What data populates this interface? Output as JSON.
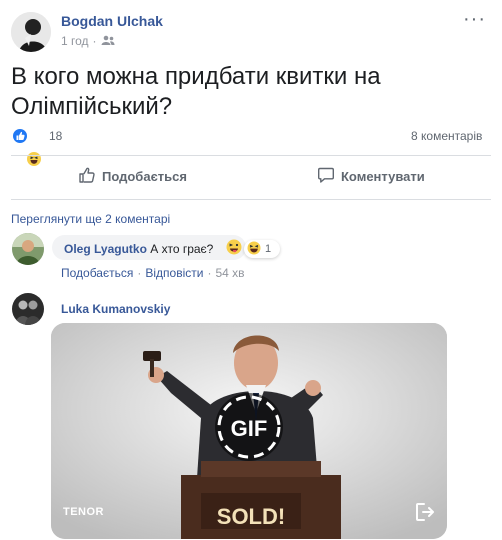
{
  "post": {
    "author": "Bogdan Ulchak",
    "time": "1 год",
    "text": "В кого можна придбати квитки на Олімпійський?",
    "reactions_count": "18",
    "comments_count": "8 коментарів"
  },
  "actions": {
    "like": "Подобається",
    "comment": "Коментувати"
  },
  "comments": {
    "view_more": "Переглянути ще 2 коментарі",
    "first": {
      "name": "Oleg Lyagutko",
      "text": "А хто грає?",
      "reaction_count": "1",
      "like": "Подобається",
      "reply": "Відповісти",
      "time": "54 хв"
    },
    "second": {
      "name": "Luka Kumanovskiy",
      "gif_provider": "TENOR",
      "gif_badge": "GIF",
      "gif_caption": "SOLD!"
    }
  },
  "icons": {
    "audience": "friends-icon",
    "like": "thumbs-up-icon",
    "comment": "speech-bubble-icon",
    "share": "share-exit-icon"
  },
  "colors": {
    "link": "#385898",
    "like_blue": "#2078f4",
    "haha_yellow": "#f7cf4b"
  }
}
